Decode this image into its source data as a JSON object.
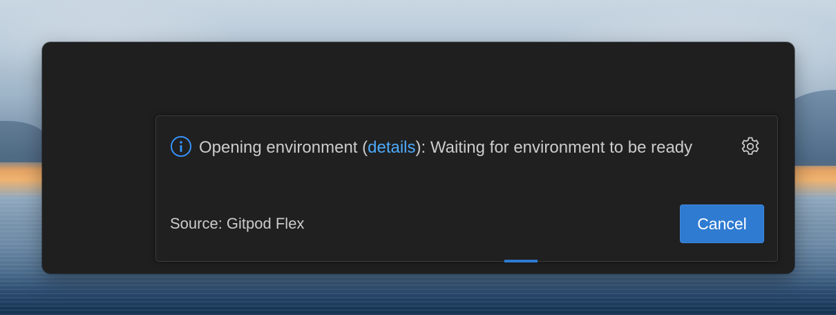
{
  "notification": {
    "message_prefix": "Opening environment (",
    "link_text": "details",
    "message_suffix": "): Waiting for environment to be ready",
    "source": "Source: Gitpod Flex",
    "cancel_label": "Cancel",
    "icon": "info-icon",
    "settings_icon": "gear-icon",
    "progress_state": "indeterminate"
  },
  "colors": {
    "accent": "#2f7bd2",
    "link": "#4daafc",
    "window_bg": "#1f1f1f",
    "text": "#cccccc"
  }
}
